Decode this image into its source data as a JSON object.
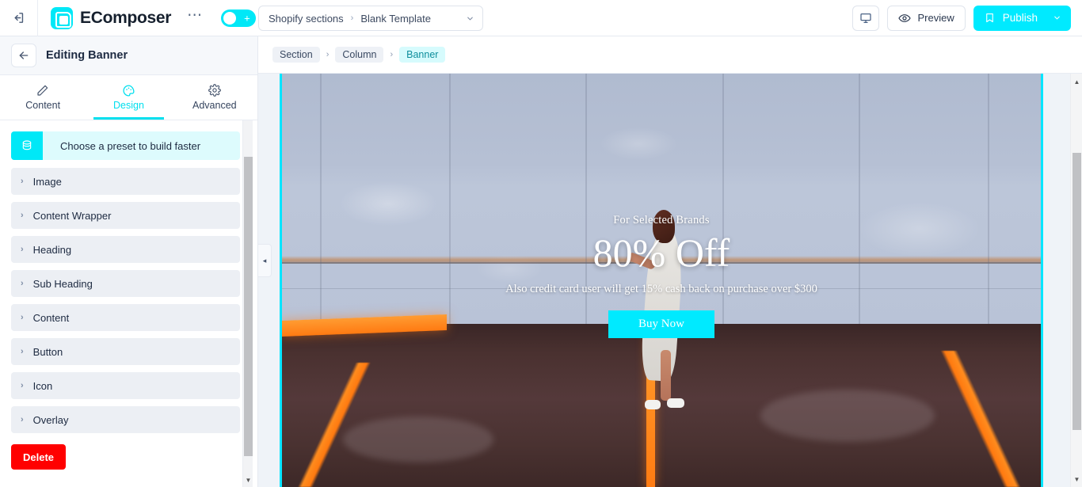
{
  "topbar": {
    "exit_icon": "exit-icon",
    "brand_name": "EComposer",
    "more_icon": "ellipsis-icon",
    "toggle_state": "on",
    "template_select": {
      "group_label": "Shopify sections",
      "separator": "›",
      "value": "Blank Template",
      "caret": "⌄"
    },
    "device_icon": "desktop-icon",
    "preview_label": "Preview",
    "preview_icon": "eye-icon",
    "publish_label": "Publish",
    "publish_icon": "bookmark-icon",
    "publish_caret": "⌄",
    "accent_color": "#00eaff"
  },
  "sidebar": {
    "back_icon": "arrow-left-icon",
    "title": "Editing Banner",
    "tabs": [
      {
        "label": "Content",
        "icon": "pencil-icon",
        "active": false
      },
      {
        "label": "Design",
        "icon": "palette-icon",
        "active": true
      },
      {
        "label": "Advanced",
        "icon": "gear-icon",
        "active": false
      }
    ],
    "preset": {
      "icon": "layers-icon",
      "label": "Choose a preset to build faster"
    },
    "sections": [
      {
        "label": "Image",
        "chevron": "›"
      },
      {
        "label": "Content Wrapper",
        "chevron": "›"
      },
      {
        "label": "Heading",
        "chevron": "›"
      },
      {
        "label": "Sub Heading",
        "chevron": "›"
      },
      {
        "label": "Content",
        "chevron": "›"
      },
      {
        "label": "Button",
        "chevron": "›"
      },
      {
        "label": "Icon",
        "chevron": "›"
      },
      {
        "label": "Overlay",
        "chevron": "›"
      }
    ],
    "delete_label": "Delete",
    "delete_color": "#ff0000",
    "scroll_up": "▲",
    "scroll_down": "▼"
  },
  "breadcrumb": {
    "items": [
      {
        "label": "Section",
        "selected": false
      },
      {
        "label": "Column",
        "selected": false
      },
      {
        "label": "Banner",
        "selected": true
      }
    ],
    "separator": "›"
  },
  "canvas": {
    "collapse_icon": "◂",
    "selection_color": "#00e5ff",
    "scroll_up": "▲",
    "scroll_down": "▼",
    "banner": {
      "sub_heading": "For Selected Brands",
      "heading": "80% Off",
      "content": "Also credit card user will get 15% cash back on purchase over $300",
      "button_label": "Buy Now",
      "button_color": "#00eaff"
    }
  }
}
